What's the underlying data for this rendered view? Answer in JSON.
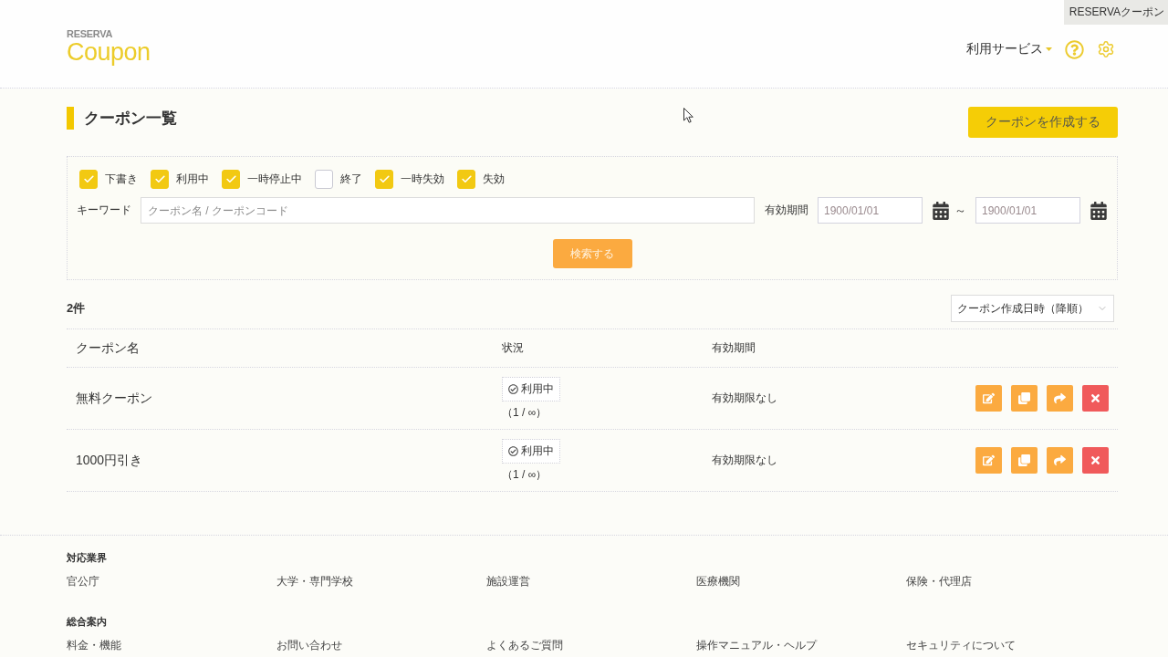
{
  "top_tab": {
    "label": "RESERVAクーポン"
  },
  "header": {
    "logo_small": "RESERVA",
    "logo_large": "Coupon",
    "service_menu": "利用サービス"
  },
  "page": {
    "title": "クーポン一覧",
    "create_button": "クーポンを作成する"
  },
  "filters": {
    "statuses": [
      {
        "label": "下書き",
        "checked": true
      },
      {
        "label": "利用中",
        "checked": true
      },
      {
        "label": "一時停止中",
        "checked": true
      },
      {
        "label": "終了",
        "checked": false
      },
      {
        "label": "一時失効",
        "checked": true
      },
      {
        "label": "失効",
        "checked": true
      }
    ],
    "keyword": {
      "label": "キーワード",
      "placeholder": "クーポン名 / クーポンコード"
    },
    "period": {
      "label": "有効期間",
      "from_placeholder": "1900/01/01",
      "separator": "～",
      "to_placeholder": "1900/01/01"
    },
    "search_button": "検索する"
  },
  "results": {
    "count": "2件",
    "sort": "クーポン作成日時（降順）"
  },
  "table": {
    "columns": [
      "クーポン名",
      "状況",
      "有効期間"
    ],
    "rows": [
      {
        "name": "無料クーポン",
        "status": "利用中",
        "usage": "（1 / ∞）",
        "period": "有効期限なし",
        "actions": [
          {
            "kind": "edit"
          },
          {
            "kind": "copy"
          },
          {
            "kind": "share"
          },
          {
            "kind": "delete"
          }
        ]
      },
      {
        "name": "1000円引き",
        "status": "利用中",
        "usage": "（1 / ∞）",
        "period": "有効期限なし",
        "actions": [
          {
            "kind": "edit"
          },
          {
            "kind": "copy"
          },
          {
            "kind": "share"
          },
          {
            "kind": "delete"
          }
        ]
      }
    ]
  },
  "footer": {
    "sections": [
      {
        "heading": "対応業界",
        "links": [
          "官公庁",
          "大学・専門学校",
          "施設運営",
          "医療機関",
          "保険・代理店"
        ]
      },
      {
        "heading": "総合案内",
        "links": [
          "料金・機能",
          "お問い合わせ",
          "よくあるご質問",
          "操作マニュアル・ヘルプ",
          "セキュリティについて"
        ]
      }
    ]
  }
}
